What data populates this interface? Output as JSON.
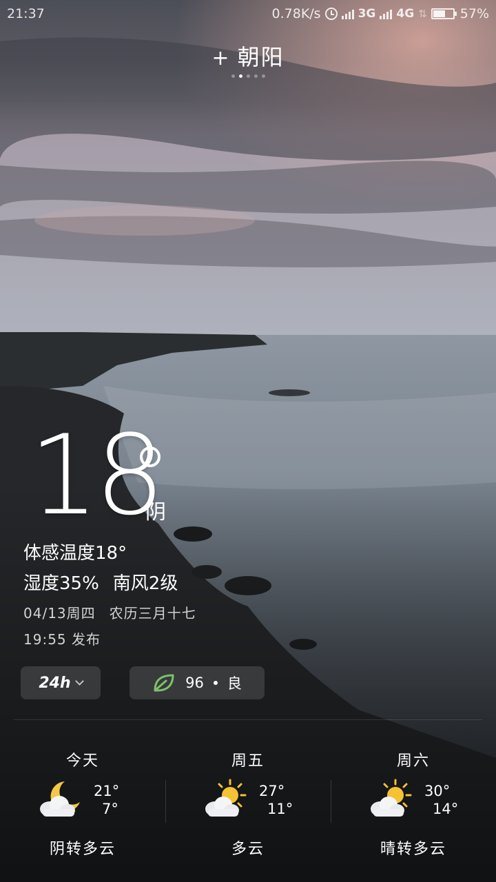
{
  "status_bar": {
    "time": "21:37",
    "net_speed": "0.78K/s",
    "net_3g": "3G",
    "net_4g": "4G",
    "battery": "57%",
    "battery_level": 0.57
  },
  "header": {
    "add_symbol": "+",
    "city": "朝阳",
    "page_count": 5,
    "active_page": 1
  },
  "current": {
    "temperature": "18",
    "condition": "阴",
    "feels_like": "体感温度18°",
    "humidity": "湿度35%",
    "wind": "南风2级",
    "date": "04/13周四",
    "lunar": "农历三月十七",
    "publish": "19:55 发布"
  },
  "chips": {
    "hourly_label": "24h",
    "aqi_value": "96",
    "aqi_level": "良"
  },
  "forecast": [
    {
      "day": "今天",
      "high": "21°",
      "low": "7°",
      "desc": "阴转多云",
      "icon": "moon-cloud-icon"
    },
    {
      "day": "周五",
      "high": "27°",
      "low": "11°",
      "desc": "多云",
      "icon": "sun-cloud-icon"
    },
    {
      "day": "周六",
      "high": "30°",
      "low": "14°",
      "desc": "晴转多云",
      "icon": "sun-cloud-icon"
    }
  ],
  "colors": {
    "aqi_leaf": "#7cc26a",
    "sun": "#f5c233",
    "moon": "#f2c847"
  }
}
